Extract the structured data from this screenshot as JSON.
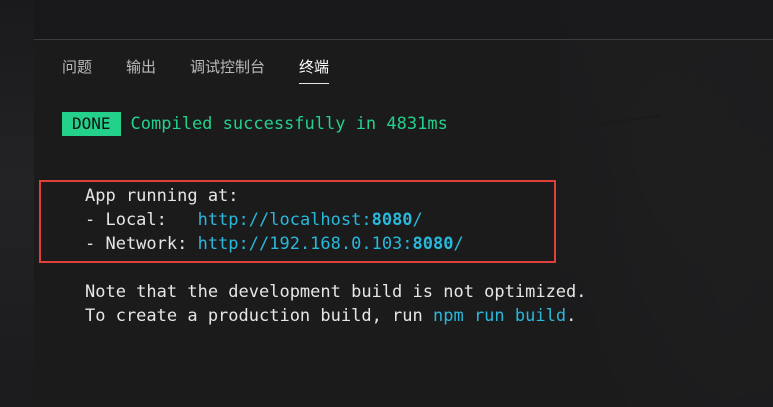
{
  "tabs": [
    {
      "label": "问题"
    },
    {
      "label": "输出"
    },
    {
      "label": "调试控制台"
    },
    {
      "label": "终端"
    }
  ],
  "active_tab": "终端",
  "terminal": {
    "done_badge": "DONE",
    "done_message": "Compiled successfully in 4831ms",
    "app_running": "App running at:",
    "local_label": "- Local:   ",
    "local_url_prefix": "http://localhost:",
    "local_url_port": "8080",
    "local_url_suffix": "/",
    "network_label": "- Network: ",
    "network_url_prefix": "http://192.168.0.103:",
    "network_url_port": "8080",
    "network_url_suffix": "/",
    "note_line1": "Note that the development build is not optimized.",
    "note_line2_prefix": "To create a production build, run ",
    "note_line2_cmd": "npm run build",
    "note_line2_suffix": "."
  },
  "colors": {
    "success": "#23d18b",
    "link": "#29b8db",
    "highlight_border": "#e0403a",
    "text": "#e6e6e6"
  }
}
